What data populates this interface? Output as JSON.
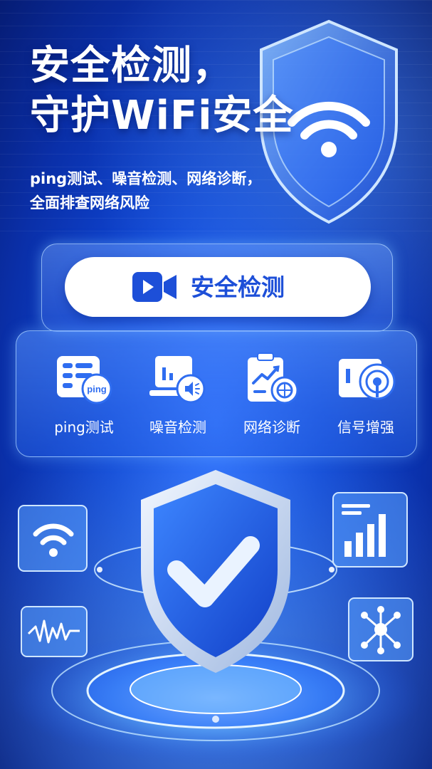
{
  "hero": {
    "title_line1": "安全检测，",
    "title_line2": "守护WiFi安全",
    "subtitle_line1": "ping测试、噪音检测、网络诊断，",
    "subtitle_line2": "全面排查网络风险"
  },
  "main_button": {
    "label": "安全检测",
    "icon": "video-camera-icon"
  },
  "features": [
    {
      "label": "ping测试",
      "icon": "ping-test-icon",
      "icon_text": "ping"
    },
    {
      "label": "噪音检测",
      "icon": "noise-detection-icon"
    },
    {
      "label": "网络诊断",
      "icon": "network-diagnosis-icon"
    },
    {
      "label": "信号增强",
      "icon": "signal-boost-icon"
    }
  ],
  "colors": {
    "background": "#0f47d6",
    "accent": "#1d4fd8",
    "button_bg": "#ffffff"
  },
  "decorations": [
    "wifi-shield-icon",
    "checkmark-shield-icon",
    "wifi-card-icon",
    "waveform-card-icon",
    "bar-chart-card-icon",
    "network-nodes-card-icon"
  ]
}
